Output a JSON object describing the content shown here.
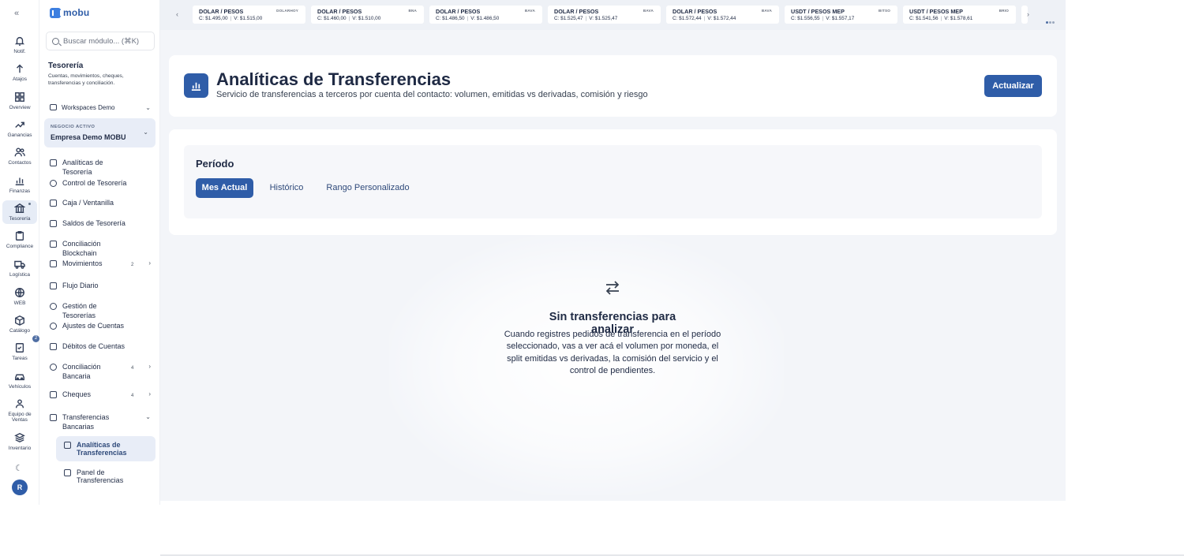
{
  "rail": {
    "items": [
      {
        "label": "Notif.",
        "icon": "bell-icon"
      },
      {
        "label": "Atajos",
        "icon": "arrow-up-icon"
      },
      {
        "label": "Overview",
        "icon": "grid-icon"
      },
      {
        "label": "Ganancias",
        "icon": "trend-icon"
      },
      {
        "label": "Contactos",
        "icon": "users-icon"
      },
      {
        "label": "Finanzas",
        "icon": "bar-chart-icon"
      },
      {
        "label": "Tesorería",
        "icon": "bank-icon"
      },
      {
        "label": "Compliance",
        "icon": "clipboard-icon"
      },
      {
        "label": "Logística",
        "icon": "truck-icon"
      },
      {
        "label": "WEB",
        "icon": "globe-icon"
      },
      {
        "label": "Catálogo",
        "icon": "box-icon"
      },
      {
        "label": "Tareas",
        "icon": "checklist-icon"
      },
      {
        "label": "Vehículos",
        "icon": "car-icon"
      },
      {
        "label": "Equipo de Ventas",
        "icon": "team-icon"
      },
      {
        "label": "Inventario",
        "icon": "layers-icon"
      }
    ],
    "catalogo_badge": "2",
    "avatar_initial": "R"
  },
  "sidebar": {
    "logo": "mobu",
    "search_placeholder": "Buscar módulo... (⌘K)",
    "module_title": "Tesorería",
    "module_desc": "Cuentas, movimientos, cheques, transferencias y conciliación.",
    "workspace": "Workspaces Demo",
    "business_label": "NEGOCIO ACTIVO",
    "business_name": "Empresa Demo MOBU",
    "items": [
      {
        "label": "Analíticas de Tesorería"
      },
      {
        "label": "Control de Tesorería"
      },
      {
        "label": "Caja / Ventanilla"
      },
      {
        "label": "Saldos de Tesorería"
      },
      {
        "label": "Conciliación Blockchain"
      },
      {
        "label": "Movimientos",
        "count": "2"
      },
      {
        "label": "Flujo Diario"
      },
      {
        "label": "Gestión de Tesorerías"
      },
      {
        "label": "Ajustes de Cuentas"
      },
      {
        "label": "Débitos de Cuentas"
      },
      {
        "label": "Conciliación Bancaria",
        "count": "4"
      },
      {
        "label": "Cheques",
        "count": "4"
      },
      {
        "label": "Transferencias Bancarias"
      }
    ],
    "sub_items": [
      {
        "label": "Analíticas de Transferencias"
      },
      {
        "label": "Panel de Transferencias"
      }
    ]
  },
  "ticker": [
    {
      "pair": "DOLAR / PESOS",
      "source": "DOLARHOY",
      "compra": "C: $1.495,00",
      "venta": "V: $1.515,00"
    },
    {
      "pair": "DOLAR / PESOS",
      "source": "BNA",
      "compra": "C: $1.460,00",
      "venta": "V: $1.510,00"
    },
    {
      "pair": "DOLAR / PESOS",
      "source": "BAVA",
      "compra": "C: $1.486,50",
      "venta": "V: $1.486,50"
    },
    {
      "pair": "DOLAR / PESOS",
      "source": "BAVA",
      "compra": "C: $1.525,47",
      "venta": "V: $1.525,47"
    },
    {
      "pair": "DOLAR / PESOS",
      "source": "BAVA",
      "compra": "C: $1.572,44",
      "venta": "V: $1.572,44"
    },
    {
      "pair": "USDT / PESOS MEP",
      "source": "BITSO",
      "compra": "C: $1.556,55",
      "venta": "V: $1.557,17"
    },
    {
      "pair": "USDT / PESOS MEP",
      "source": "BRIO",
      "compra": "C: $1.541,56",
      "venta": "V: $1.578,61"
    }
  ],
  "header": {
    "title": "Analíticas de Transferencias",
    "subtitle": "Servicio de transferencias a terceros por cuenta del contacto: volumen, emitidas vs derivadas, comisión y riesgo",
    "refresh_label": "Actualizar"
  },
  "period": {
    "title": "Período",
    "tabs": [
      {
        "label": "Mes Actual",
        "active": true
      },
      {
        "label": "Histórico",
        "active": false
      },
      {
        "label": "Rango Personalizado",
        "active": false
      }
    ]
  },
  "empty": {
    "title": "Sin transferencias para analizar",
    "text": "Cuando registres pedidos de transferencia en el período seleccionado, vas a ver acá el volumen por moneda, el split emitidas vs derivadas, la comisión del servicio y el control de pendientes."
  },
  "colors": {
    "accent": "#2f5da8",
    "active_bg": "#e8edf7",
    "ticker_bg": "#eef1f6",
    "main_bg": "#f3f5f9"
  }
}
